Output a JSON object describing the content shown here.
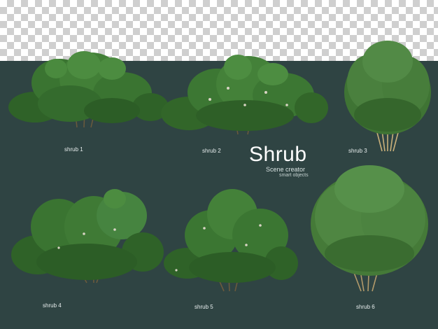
{
  "background": {
    "panel_color": "#2f4443",
    "transparency_pattern": "checkerboard"
  },
  "title": {
    "main": "Shrub",
    "line2": "Scene creator",
    "line3": "smart objects"
  },
  "shrubs": [
    {
      "label": "shrub 1",
      "color": "#3f7a35",
      "icon": "broadleaf-shrub"
    },
    {
      "label": "shrub 2",
      "color": "#417d36",
      "icon": "flowering-shrub"
    },
    {
      "label": "shrub 3",
      "color": "#4c7f3c",
      "icon": "columnar-shrub"
    },
    {
      "label": "shrub 4",
      "color": "#3a7532",
      "icon": "spreading-shrub"
    },
    {
      "label": "shrub 5",
      "color": "#3c7834",
      "icon": "flowering-shrub"
    },
    {
      "label": "shrub 6",
      "color": "#4d823e",
      "icon": "rounded-shrub"
    }
  ]
}
